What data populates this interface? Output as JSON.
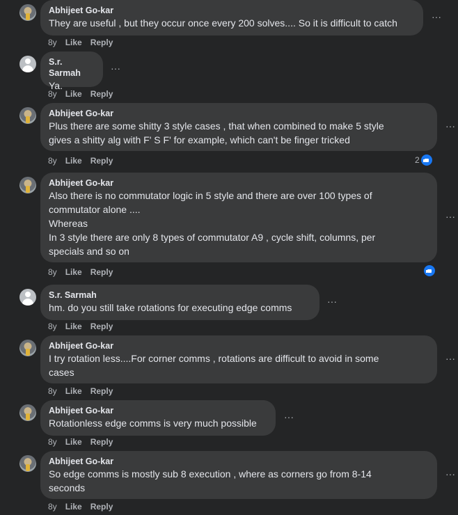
{
  "menu_glyph": "···",
  "actions": {
    "like": "Like",
    "reply": "Reply"
  },
  "comments": [
    {
      "author": "Abhijeet Go-kar",
      "avatar": "photo",
      "text": "They are useful , but they occur once every 200 solves.... So it is difficult to catch",
      "time": "8y"
    },
    {
      "author": "S.r. Sarmah",
      "avatar": "default",
      "text": "Ya.",
      "time": "8y"
    },
    {
      "author": "Abhijeet Go-kar",
      "avatar": "photo",
      "text": "Plus there are some shitty 3 style cases , that when combined to make 5 style\ngives a shitty alg with F' S F' for example, which can't be finger tricked",
      "time": "8y",
      "reaction_count": "2",
      "reaction_icon": "like-icon"
    },
    {
      "author": "Abhijeet Go-kar",
      "avatar": "photo",
      "text": "Also there is no commutator logic in 5 style and there are over 100 types of\ncommutator alone ....\nWhereas\nIn 3 style there are only 8 types of commutator A9 , cycle shift, columns, per\nspecials and so on",
      "time": "8y",
      "reaction_icon": "like-icon"
    },
    {
      "author": "S.r. Sarmah",
      "avatar": "default",
      "text": "hm. do you still take rotations for executing edge comms",
      "time": "8y"
    },
    {
      "author": "Abhijeet Go-kar",
      "avatar": "photo",
      "text": "I try rotation less....For corner comms , rotations are difficult to avoid in some\ncases",
      "time": "8y"
    },
    {
      "author": "Abhijeet Go-kar",
      "avatar": "photo",
      "text": "Rotationless edge comms is very much possible",
      "time": "8y"
    },
    {
      "author": "Abhijeet Go-kar",
      "avatar": "photo",
      "text": "So edge comms is mostly sub 8 execution , where as corners go from 8-14\nseconds",
      "time": "8y"
    }
  ]
}
